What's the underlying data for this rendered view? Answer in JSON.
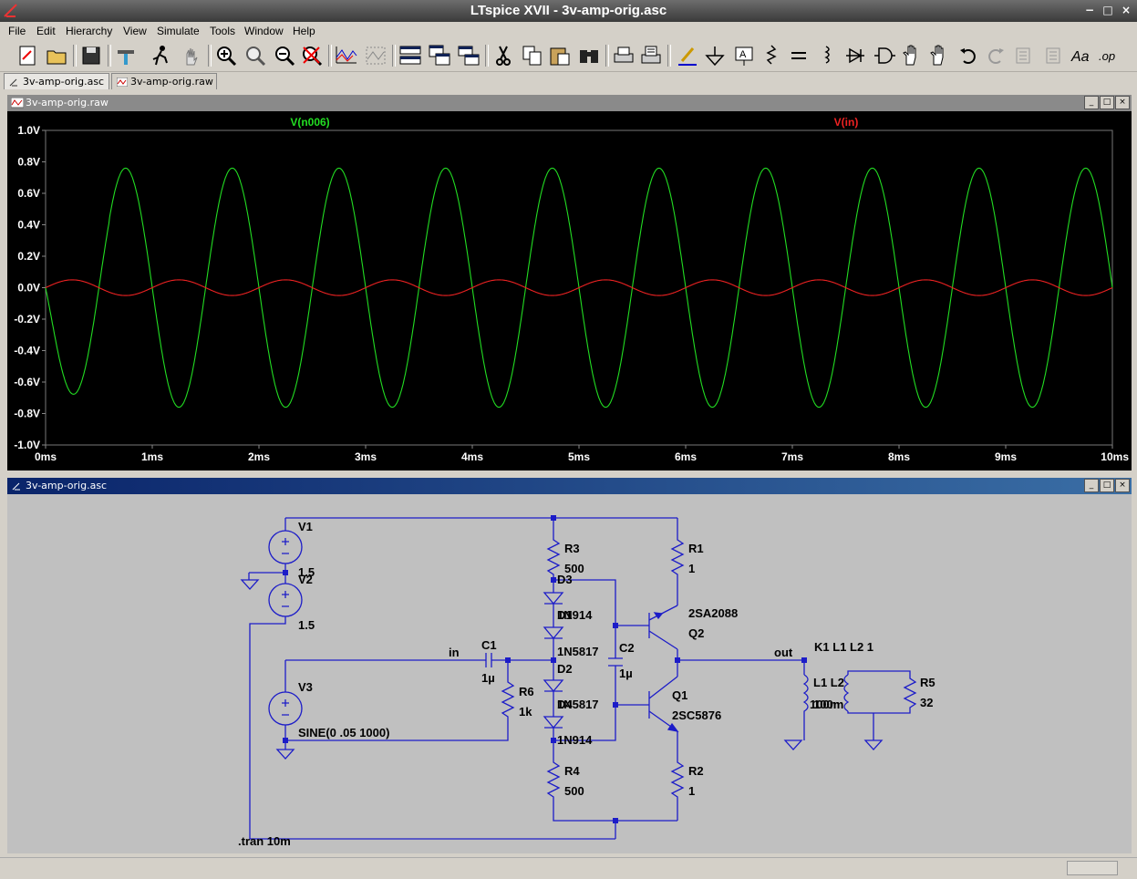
{
  "window": {
    "title": "LTspice XVII - 3v-amp-orig.asc",
    "min": "−",
    "max": "□",
    "close": "×"
  },
  "menu": [
    "File",
    "Edit",
    "Hierarchy",
    "View",
    "Simulate",
    "Tools",
    "Window",
    "Help"
  ],
  "toolbar": [
    "new-schematic-icon",
    "open-icon",
    "save-icon",
    "control-panel-icon",
    "run-icon",
    "halt-icon",
    "zoom-in-icon",
    "pan-icon",
    "zoom-out-icon",
    "zoom-fit-icon",
    "autoscale-icon",
    "waveform-icon",
    "tile-horizontal-icon",
    "cascade-icon",
    "tile-vertical-icon",
    "cut-icon",
    "copy-icon",
    "paste-icon",
    "find-icon",
    "print-icon",
    "print-setup-icon",
    "wire-icon",
    "ground-icon",
    "label-icon",
    "resistor-icon",
    "capacitor-icon",
    "inductor-icon",
    "diode-icon",
    "component-icon",
    "move-icon",
    "drag-icon",
    "undo-icon",
    "redo-icon",
    "rotate-icon",
    "mirror-icon",
    "text-icon",
    "spice-directive-icon"
  ],
  "toolbar_texts": {
    "text_tool": "Aa",
    "op_tool": ".op"
  },
  "tabs": [
    {
      "label": "3v-amp-orig.asc",
      "active": true
    },
    {
      "label": "3v-amp-orig.raw",
      "active": false
    }
  ],
  "plot_window": {
    "title": "3v-amp-orig.raw",
    "background": "#000000",
    "chart_data": {
      "type": "line",
      "xlabel": "",
      "ylabel": "",
      "xlim": [
        0,
        10
      ],
      "ylim": [
        -1.0,
        1.0
      ],
      "x_ticks": [
        "0ms",
        "1ms",
        "2ms",
        "3ms",
        "4ms",
        "5ms",
        "6ms",
        "7ms",
        "8ms",
        "9ms",
        "10ms"
      ],
      "y_ticks": [
        "1.0V",
        "0.8V",
        "0.6V",
        "0.4V",
        "0.2V",
        "0.0V",
        "-0.2V",
        "-0.4V",
        "-0.6V",
        "-0.8V",
        "-1.0V"
      ],
      "grid": false,
      "series": [
        {
          "name": "V(n006)",
          "color": "#22dd22",
          "frequency_hz": 1000,
          "amplitude_v": 0.76,
          "phase": "inverted",
          "first_trough_v": -0.53,
          "end_value_v": -0.62
        },
        {
          "name": "V(in)",
          "color": "#ee2222",
          "frequency_hz": 1000,
          "amplitude_v": 0.05,
          "phase": "sine"
        }
      ]
    }
  },
  "schematic_window": {
    "title": "3v-amp-orig.asc",
    "wire_color": "#1c1cc8",
    "labels": {
      "v1": "V1",
      "v1v": "1.5",
      "v2": "V2",
      "v2v": "1.5",
      "v3": "V3",
      "v3v": "SINE(0 .05 1000)",
      "r3": "R3",
      "r3v": "500",
      "r1": "R1",
      "r1v": "1",
      "d3": "D3",
      "d3v": "1N914",
      "d1v": "1N5817",
      "d2": "D2",
      "d2v": "1N5817",
      "d4v": "1N914",
      "dl_top": "D1",
      "dl_bot": "D4",
      "q2v": "2SA2088",
      "q2": "Q2",
      "q1": "Q1",
      "q1v": "2SC5876",
      "c1": "C1",
      "c1v": "1µ",
      "c2": "C2",
      "c2v": "1µ",
      "r6": "R6",
      "r6v": "1k",
      "r4": "R4",
      "r4v": "500",
      "r2": "R2",
      "r2v": "1",
      "in": "in",
      "out": "out",
      "k1": "K1 L1 L2 1",
      "l1l2": "L1 L2",
      "lval": "100m",
      "lval2": "100m",
      "r5": "R5",
      "r5v": "32",
      "tran": ".tran 10m"
    }
  }
}
